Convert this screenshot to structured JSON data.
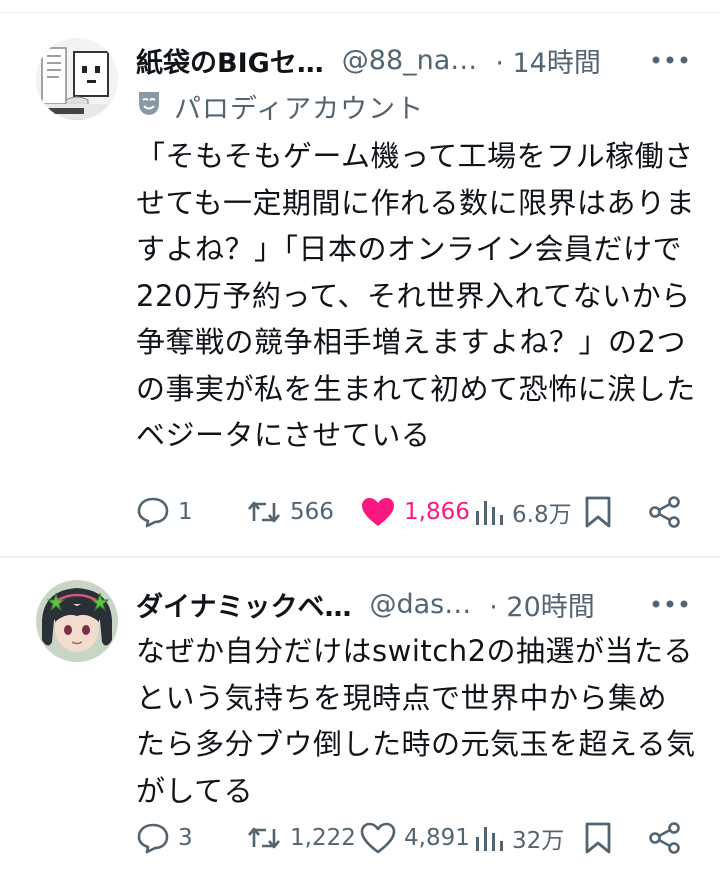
{
  "tweets": [
    {
      "display_name": "紙袋のBIGセ…",
      "handle": "@88_na…",
      "time": "· 14時間",
      "parody_label": "パロディアカウント",
      "body": "「そもそもゲーム機って工場をフル稼働させても一定期間に作れる数に限界はありますよね？」「日本のオンライン会員だけで220万予約って、それ世界入れてないから争奪戦の競争相手増えますよね？」の2つの事実が私を生まれて初めて恐怖に涙したベジータにさせている",
      "replies": "1",
      "retweets": "566",
      "likes": "1,866",
      "liked": true,
      "views": "6.8万"
    },
    {
      "display_name": "ダイナミックベ…",
      "handle": "@das…",
      "time": "· 20時間",
      "body": "なぜか自分だけはswitch2の抽選が当たるという気持ちを現時点で世界中から集めたら多分ブウ倒した時の元気玉を超える気がしてる",
      "replies": "3",
      "retweets": "1,222",
      "likes": "4,891",
      "liked": false,
      "views": "32万"
    }
  ],
  "colors": {
    "text": "#0f1419",
    "secondary": "#536471",
    "like_active": "#f91880",
    "divider": "#eff3f4"
  },
  "icons": [
    "more-icon",
    "parody-mask-icon",
    "reply-icon",
    "retweet-icon",
    "like-icon",
    "views-icon",
    "bookmark-icon",
    "share-icon"
  ]
}
